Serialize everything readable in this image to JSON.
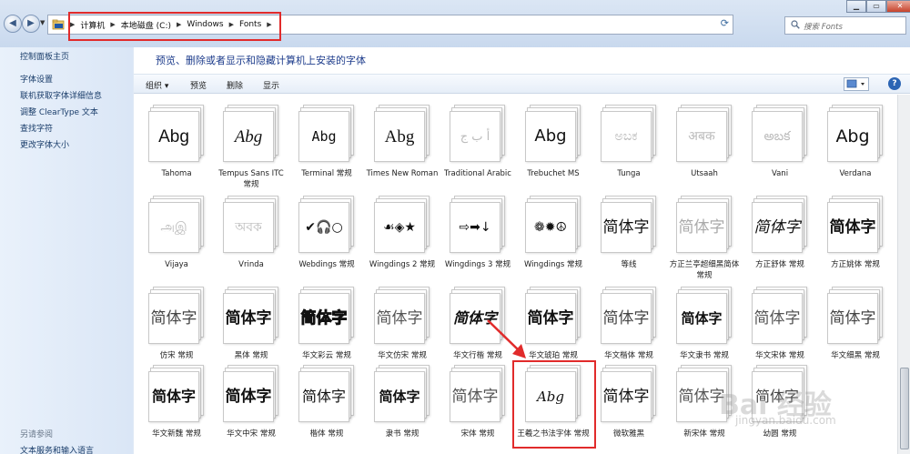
{
  "address_bar": {
    "crumbs": [
      "计算机",
      "本地磁盘 (C:)",
      "Windows",
      "Fonts"
    ],
    "search_placeholder": "搜索 Fonts"
  },
  "left_pane": {
    "top_links": [
      "控制面板主页",
      "字体设置",
      "联机获取字体详细信息",
      "调整 ClearType 文本",
      "查找字符",
      "更改字体大小"
    ],
    "see_also_heading": "另请参阅",
    "see_also_links": [
      "文本服务和输入语言"
    ]
  },
  "main": {
    "banner": "预览、删除或者显示和隐藏计算机上安装的字体",
    "toolbar": {
      "organize": "组织 ▾",
      "preview": "预览",
      "delete": "删除",
      "show": "显示"
    }
  },
  "fonts": [
    {
      "name": "Tahoma",
      "sample": "Abg"
    },
    {
      "name": "Tempus Sans ITC 常规",
      "sample": "Abg"
    },
    {
      "name": "Terminal 常规",
      "sample": "Abg"
    },
    {
      "name": "Times New Roman",
      "sample": "Abg"
    },
    {
      "name": "Traditional Arabic",
      "sample": "أ ب ج"
    },
    {
      "name": "Trebuchet MS",
      "sample": "Abg"
    },
    {
      "name": "Tunga",
      "sample": "ಅಬಕ"
    },
    {
      "name": "Utsaah",
      "sample": "अबक"
    },
    {
      "name": "Vani",
      "sample": "అబక"
    },
    {
      "name": "Verdana",
      "sample": "Abg"
    },
    {
      "name": "Vijaya",
      "sample": "அஇ"
    },
    {
      "name": "Vrinda",
      "sample": "অবক"
    },
    {
      "name": "Webdings 常规",
      "sample": "✔🎧○"
    },
    {
      "name": "Wingdings 2 常规",
      "sample": "☙◈★"
    },
    {
      "name": "Wingdings 3 常规",
      "sample": "⇨➡↓"
    },
    {
      "name": "Wingdings 常规",
      "sample": "❁✹☮"
    },
    {
      "name": "等线",
      "sample": "简体字"
    },
    {
      "name": "方正兰亭超细黑简体 常规",
      "sample": "简体字"
    },
    {
      "name": "方正舒体 常规",
      "sample": "简体字"
    },
    {
      "name": "方正姚体 常规",
      "sample": "简体字"
    },
    {
      "name": "仿宋 常规",
      "sample": "简体字"
    },
    {
      "name": "黑体 常规",
      "sample": "简体字"
    },
    {
      "name": "华文彩云 常规",
      "sample": "简体字"
    },
    {
      "name": "华文仿宋 常规",
      "sample": "简体字"
    },
    {
      "name": "华文行楷 常规",
      "sample": "简体字"
    },
    {
      "name": "华文琥珀 常规",
      "sample": "简体字"
    },
    {
      "name": "华文楷体 常规",
      "sample": "简体字"
    },
    {
      "name": "华文隶书 常规",
      "sample": "简体字"
    },
    {
      "name": "华文宋体 常规",
      "sample": "简体字"
    },
    {
      "name": "华文细黑 常规",
      "sample": "简体字"
    },
    {
      "name": "华文新魏 常规",
      "sample": "简体字"
    },
    {
      "name": "华文中宋 常规",
      "sample": "简体字"
    },
    {
      "name": "楷体 常规",
      "sample": "简体字"
    },
    {
      "name": "隶书 常规",
      "sample": "简体字"
    },
    {
      "name": "宋体 常规",
      "sample": "简体字"
    },
    {
      "name": "王羲之书法字体 常规",
      "sample": "Abg"
    },
    {
      "name": "微软雅黑",
      "sample": "简体字"
    },
    {
      "name": "新宋体 常规",
      "sample": "简体字"
    },
    {
      "name": "幼圆 常规",
      "sample": "简体字"
    }
  ],
  "watermark": {
    "text": "Bai 经验",
    "sub": "jingyan.baidu.com"
  },
  "colors": {
    "highlight": "#e12b2b",
    "banner_text": "#1e3d8c",
    "link_text": "#1a3d6a"
  }
}
